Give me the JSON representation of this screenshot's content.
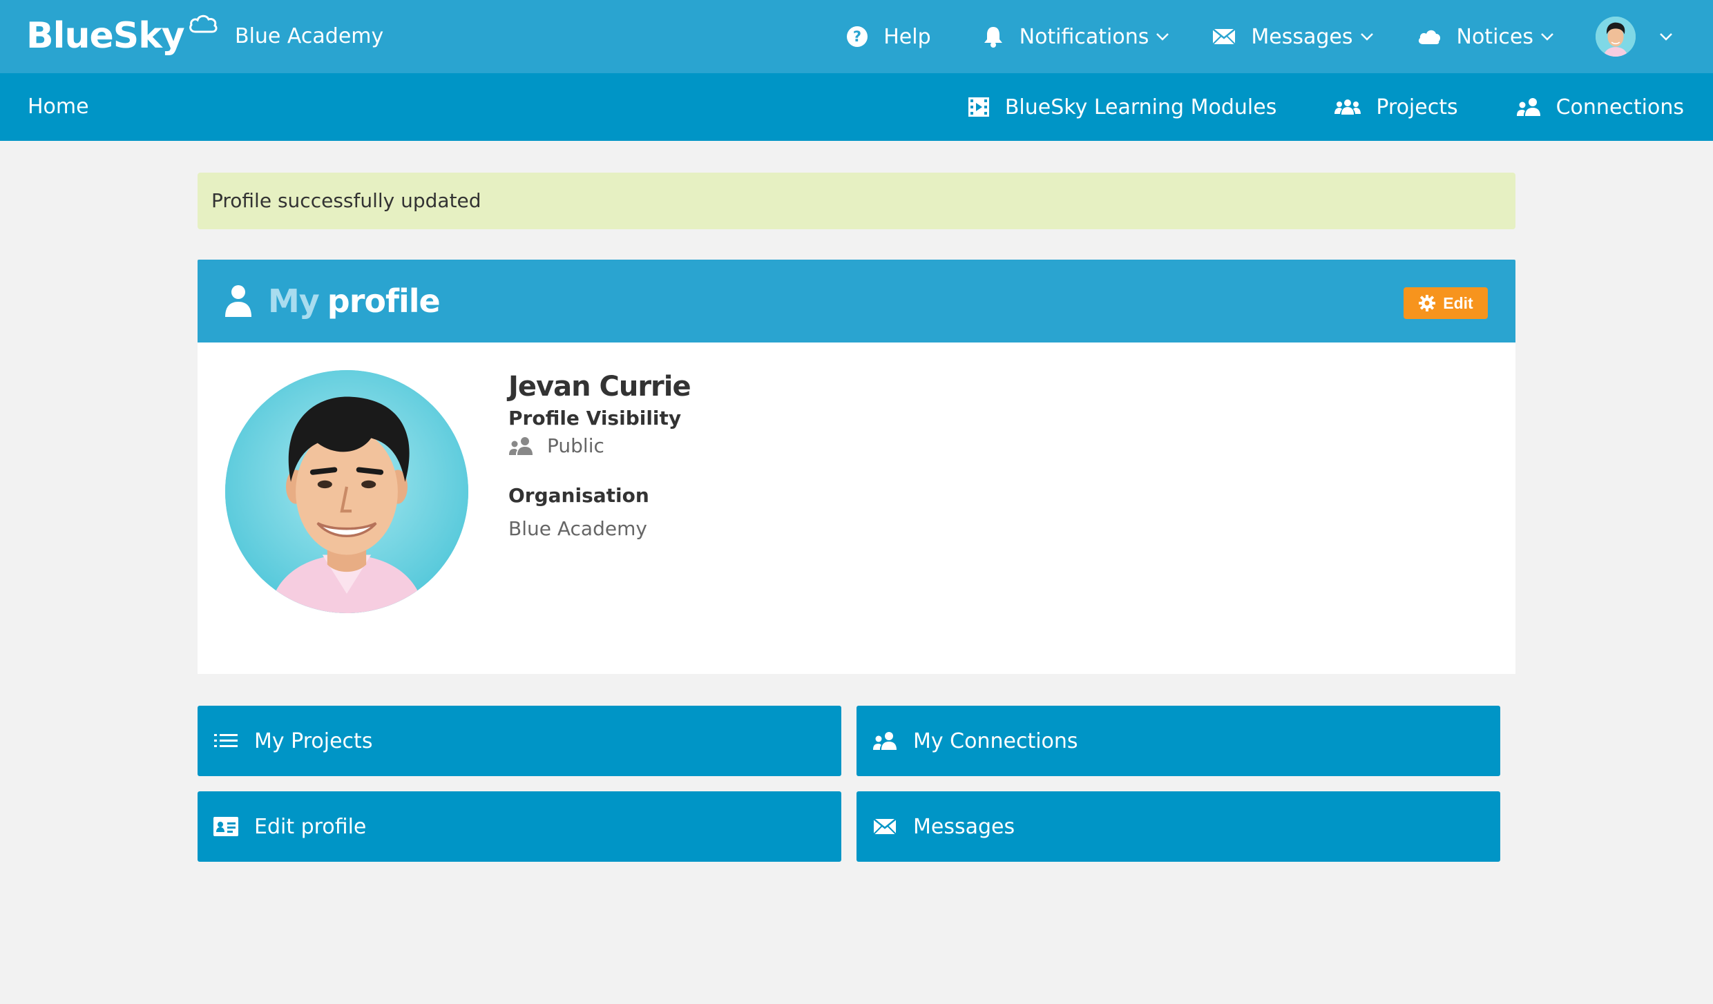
{
  "header": {
    "logo_text": "BlueSky",
    "org_name": "Blue Academy",
    "nav": {
      "help": "Help",
      "notifications": "Notifications",
      "messages": "Messages",
      "notices": "Notices"
    }
  },
  "subnav": {
    "home": "Home",
    "modules": "BlueSky Learning Modules",
    "projects": "Projects",
    "connections": "Connections"
  },
  "alert": {
    "text": "Profile successfully updated"
  },
  "profile": {
    "title_my": "My",
    "title_profile": "profile",
    "edit_label": "Edit",
    "name": "Jevan Currie",
    "visibility_label": "Profile Visibility",
    "visibility_value": "Public",
    "organisation_label": "Organisation",
    "organisation_value": "Blue Academy"
  },
  "tiles": {
    "my_projects": "My Projects",
    "my_connections": "My Connections",
    "edit_profile": "Edit profile",
    "messages": "Messages"
  },
  "colors": {
    "header_blue": "#2aa4d0",
    "nav_blue": "#0095c6",
    "accent_orange": "#f7941d",
    "alert_green": "#e6f0c2"
  },
  "icons": [
    "cloud-icon",
    "help-icon",
    "bell-icon",
    "envelope-icon",
    "cloud-icon",
    "chevron-down-icon",
    "film-icon",
    "group-icon",
    "connections-icon",
    "user-icon",
    "gear-icon",
    "list-icon",
    "id-card-icon"
  ]
}
